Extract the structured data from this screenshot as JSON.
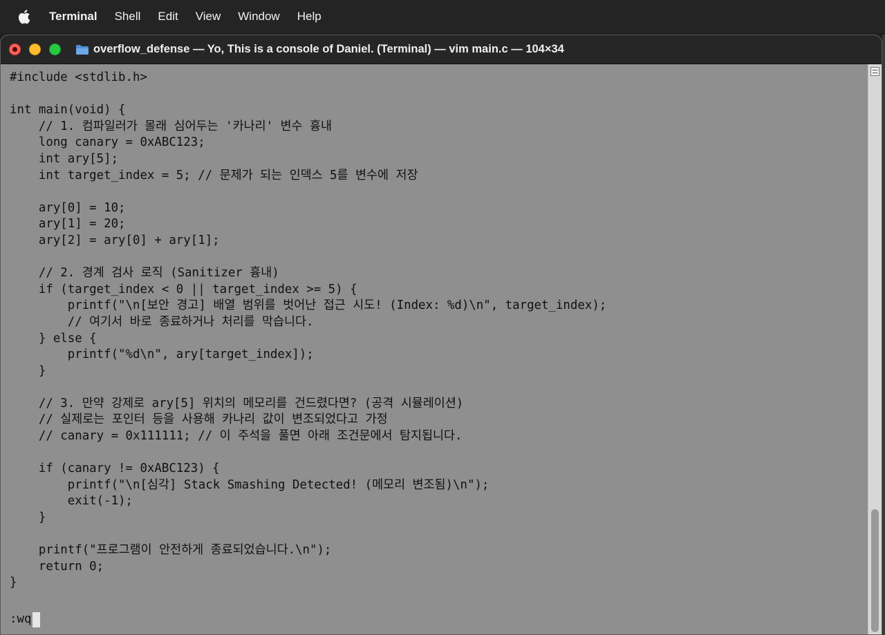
{
  "menubar": {
    "app_name": "Terminal",
    "items": [
      "Shell",
      "Edit",
      "View",
      "Window",
      "Help"
    ]
  },
  "window": {
    "title": "overflow_defense — Yo, This is a console of Daniel. (Terminal) — vim main.c — 104×34"
  },
  "editor": {
    "lines": [
      "#include <stdlib.h>",
      "",
      "int main(void) {",
      "    // 1. 컴파일러가 몰래 심어두는 '카나리' 변수 흉내",
      "    long canary = 0xABC123;",
      "    int ary[5];",
      "    int target_index = 5; // 문제가 되는 인덱스 5를 변수에 저장",
      "",
      "    ary[0] = 10;",
      "    ary[1] = 20;",
      "    ary[2] = ary[0] + ary[1];",
      "",
      "    // 2. 경계 검사 로직 (Sanitizer 흉내)",
      "    if (target_index < 0 || target_index >= 5) {",
      "        printf(\"\\n[보안 경고] 배열 범위를 벗어난 접근 시도! (Index: %d)\\n\", target_index);",
      "        // 여기서 바로 종료하거나 처리를 막습니다.",
      "    } else {",
      "        printf(\"%d\\n\", ary[target_index]);",
      "    }",
      "",
      "    // 3. 만약 강제로 ary[5] 위치의 메모리를 건드렸다면? (공격 시뮬레이션)",
      "    // 실제로는 포인터 등을 사용해 카나리 값이 변조되었다고 가정",
      "    // canary = 0x111111; // 이 주석을 풀면 아래 조건문에서 탐지됩니다.",
      "",
      "    if (canary != 0xABC123) {",
      "        printf(\"\\n[심각] Stack Smashing Detected! (메모리 변조됨)\\n\");",
      "        exit(-1);",
      "    }",
      "",
      "    printf(\"프로그램이 안전하게 종료되었습니다.\\n\");",
      "    return 0;",
      "}"
    ],
    "command": ":wq"
  },
  "colors": {
    "editor_bg": "#8f8f8f",
    "text": "#111111",
    "titlebar_bg": "#262626",
    "menubar_bg": "#242424"
  }
}
